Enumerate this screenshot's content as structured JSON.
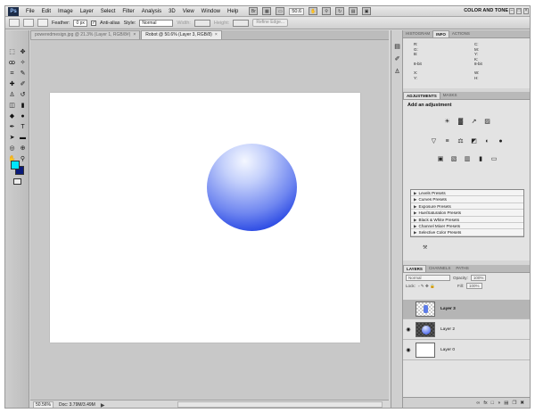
{
  "menubar": {
    "logo": "Ps",
    "items": [
      "File",
      "Edit",
      "Image",
      "Layer",
      "Select",
      "Filter",
      "Analysis",
      "3D",
      "View",
      "Window",
      "Help"
    ],
    "zoom": "50.6",
    "workspace": "COLOR AND TONE",
    "controls": [
      "–",
      "□",
      "×"
    ]
  },
  "options": {
    "feather_label": "Feather:",
    "feather_value": "0 px",
    "antialias_label": "Anti-alias",
    "antialias_checked": "✓",
    "style_label": "Style:",
    "style_value": "Normal",
    "width_label": "Width:",
    "height_label": "Height:",
    "refine_edge": "Refine Edge..."
  },
  "tabs": [
    {
      "label": "poweredmesign.jpg @ 21.3% (Layer 1, RGB/8#)",
      "close": "×"
    },
    {
      "label": "Robot @ 50.6% (Layer 3, RGB/8)",
      "close": "×"
    }
  ],
  "status": {
    "zoom": "50.56%",
    "doc": "Doc: 3.79M/3.49M",
    "arrow": "▶"
  },
  "info_panel": {
    "tabs": [
      "HISTOGRAM",
      "INFO",
      "ACTIONS"
    ],
    "col1": "R:\nG:\nB:\n\n8-bit",
    "col2": "C:\nM:\nY:\nK:\n8-bit",
    "col3": "X:\nY:",
    "col4": "W:\nH:"
  },
  "adjustments": {
    "tabs": [
      "ADJUSTMENTS",
      "MASKS"
    ],
    "title": "Add an adjustment",
    "row1": [
      "☀",
      "▓",
      "↗",
      "▨"
    ],
    "row2": [
      "▽",
      "≡",
      "⚖",
      "◩",
      "◐",
      "●"
    ],
    "row3": [
      "▣",
      "▧",
      "▥",
      "▮",
      "▭"
    ],
    "presets": [
      "Levels Presets",
      "Curves Presets",
      "Exposure Presets",
      "Hue/Saturation Presets",
      "Black & White Presets",
      "Channel Mixer Presets",
      "Selective Color Presets"
    ],
    "preset_arrow": "▶",
    "footer": "⚒"
  },
  "layers": {
    "tabs": [
      "LAYERS",
      "CHANNELS",
      "PATHS"
    ],
    "blend_mode": "Normal",
    "opacity_label": "Opacity:",
    "opacity_value": "100%",
    "lock_label": "Lock:",
    "fill_label": "Fill:",
    "fill_value": "100%",
    "items": [
      {
        "name": "Layer 3",
        "eye": "",
        "selected": true
      },
      {
        "name": "Layer 2",
        "eye": "◉",
        "selected": false
      },
      {
        "name": "Layer 0",
        "eye": "◉",
        "selected": false
      }
    ],
    "footer_icons": [
      "∞",
      "fx",
      "□",
      "◑",
      "▤",
      "❐",
      "✖"
    ]
  },
  "colors": {
    "foreground": "#00e5ff",
    "background": "#0a1a7a",
    "ball_edge": "#1230d6"
  }
}
